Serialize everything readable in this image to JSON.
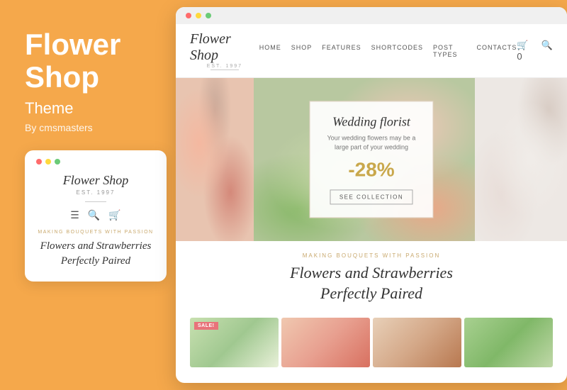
{
  "left": {
    "title_line1": "Flower",
    "title_line2": "Shop",
    "subtitle": "Theme",
    "by": "By cmsmasters",
    "mobile_logo": "Flower Shop",
    "mobile_est": "EST. 1997",
    "mobile_tagline": "Making Bouquets with Passion",
    "mobile_heading": "Flowers and Strawberries Perfectly Paired"
  },
  "browser": {
    "dots": [
      "red",
      "yellow",
      "green"
    ],
    "nav": {
      "logo": "Flower Shop",
      "est": "EST. 1997",
      "links": [
        "Home",
        "Shop",
        "Features",
        "Shortcodes",
        "Post Types",
        "Contacts"
      ],
      "cart_count": "0"
    },
    "hero": {
      "title": "Wedding florist",
      "subtitle": "Your wedding flowers may be a large part of your wedding",
      "discount": "-28%",
      "button": "SEE COLLECTION"
    },
    "content": {
      "tagline": "Making Bouquets with Passion",
      "heading_line1": "Flowers and Strawberries",
      "heading_line2": "Perfectly Paired"
    },
    "products": [
      {
        "id": 1,
        "sale": true
      },
      {
        "id": 2,
        "sale": false
      },
      {
        "id": 3,
        "sale": false
      },
      {
        "id": 4,
        "sale": false
      }
    ]
  }
}
